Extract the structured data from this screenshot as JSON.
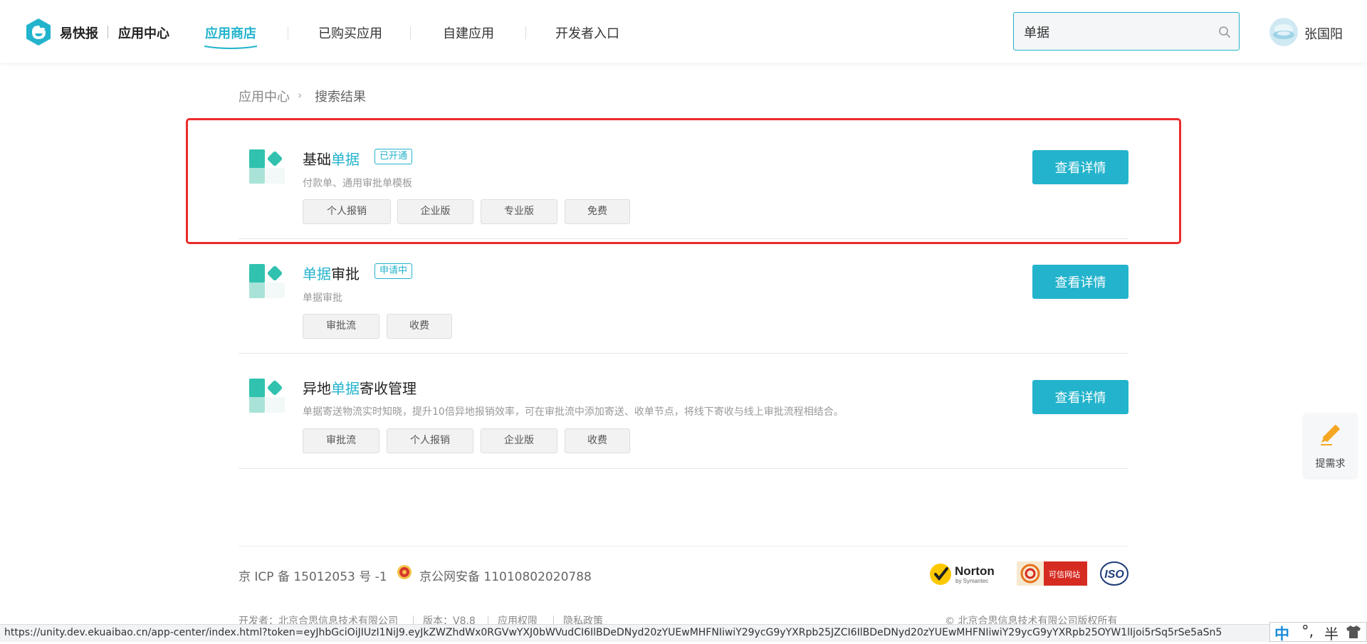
{
  "header": {
    "brand": "易快报",
    "brand_sub": "应用中心",
    "nav": [
      {
        "label": "应用商店",
        "active": true
      },
      {
        "label": "已购买应用",
        "active": false
      },
      {
        "label": "自建应用",
        "active": false
      },
      {
        "label": "开发者入口",
        "active": false
      }
    ],
    "search_value": "单据",
    "user_name": "张国阳"
  },
  "breadcrumb": {
    "root": "应用中心",
    "separator": "›",
    "current": "搜索结果"
  },
  "results": [
    {
      "title_parts": [
        "基础",
        "单据",
        ""
      ],
      "status": "已开通",
      "description": "付款单、通用审批单模板",
      "tags": [
        "个人报销",
        "企业版",
        "专业版",
        "免费"
      ],
      "button": "查看详情"
    },
    {
      "title_parts": [
        "",
        "单据",
        "审批"
      ],
      "status": "申请中",
      "description": "单据审批",
      "tags": [
        "审批流",
        "收费"
      ],
      "button": "查看详情"
    },
    {
      "title_parts": [
        "异地",
        "单据",
        "寄收管理"
      ],
      "status": "",
      "description": "单据寄送物流实时知晓，提升10倍异地报销效率，可在审批流中添加寄送、收单节点，将线下寄收与线上审批流程相结合。",
      "tags": [
        "审批流",
        "个人报销",
        "企业版",
        "收费"
      ],
      "button": "查看详情"
    }
  ],
  "float_request": {
    "label": "提需求",
    "icon": "pencil-icon"
  },
  "footer": {
    "icp": "京 ICP 备 15012053 号 -1",
    "police": "京公网安备 11010802020788",
    "norton_brand": "Norton",
    "norton_sub": "by Symantec",
    "cert_label": "可信网站",
    "iso_label": "ISO",
    "developer": "开发者：北京合思信息技术有限公司",
    "version": "版本：V8.8",
    "permissions": "应用权限",
    "privacy": "隐私政策",
    "copyright": "© 北京合思信息技术有限公司版权所有"
  },
  "statusbar": {
    "url": "https://unity.dev.ekuaibao.cn/app-center/index.html?token=eyJhbGciOiJIUzI1NiJ9.eyJkZWZhdWx0RGVwYXJ0bWVudCI6IlBDeDNyd20zYUEwMHFNIiwiY29ycG9yYXRpb25JZCI6IlBDeDNyd20zYUEwMHFNIiwiY29ycG9yYXRpb25OYW1lIjoi5rSq5rSe5aSn5"
  },
  "ime": {
    "mode": "中",
    "punct": "°,",
    "width": "半"
  },
  "colors": {
    "accent": "#23b3cc",
    "highlight_border": "#ec2b2b"
  }
}
